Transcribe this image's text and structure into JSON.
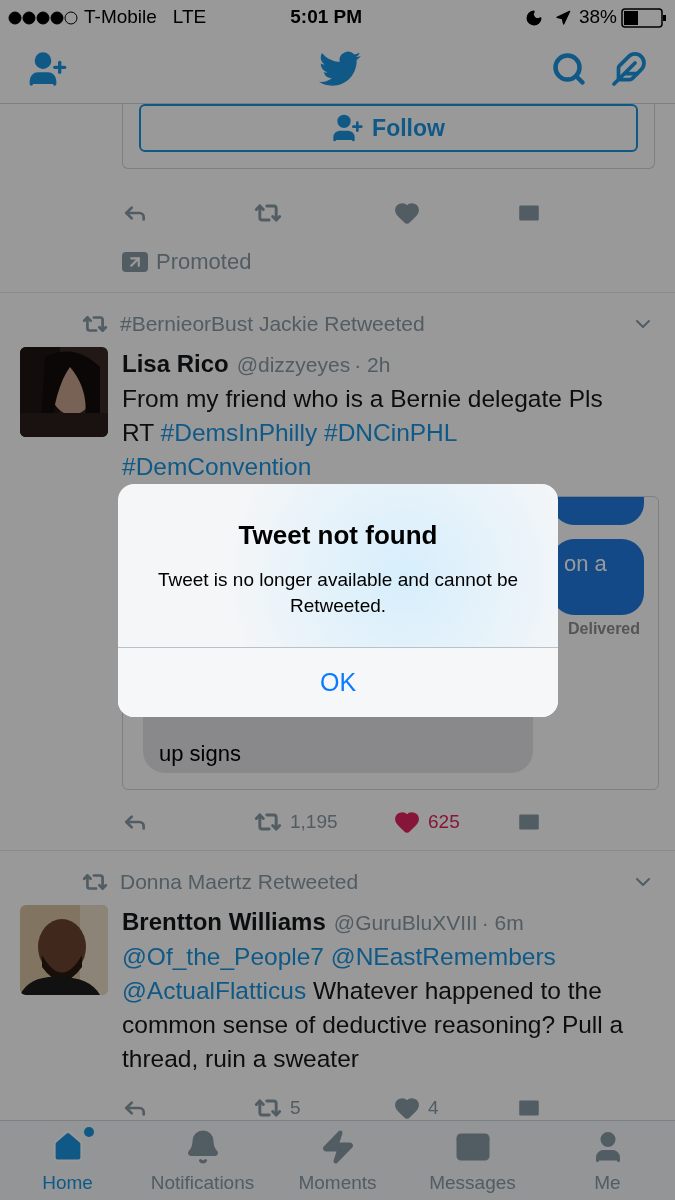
{
  "status_bar": {
    "carrier": "T-Mobile",
    "network": "LTE",
    "time": "5:01 PM",
    "battery": "38%"
  },
  "promoted_tweet": {
    "follow_button": "Follow",
    "promoted_label": "Promoted"
  },
  "tweets": [
    {
      "retweeted_by": "#BernieorBust Jackie Retweeted",
      "name": "Lisa Rico",
      "handle": "@dizzyeyes",
      "time": "· 2h",
      "text": [
        {
          "kind": "plain",
          "text": "From my friend who is a Bernie delegate Pls RT"
        },
        {
          "kind": "link",
          "text": "#DemsInPhilly"
        },
        {
          "kind": "link",
          "text": "#DNCinPHL"
        },
        {
          "kind": "link",
          "text": "#DemConvention"
        }
      ],
      "media": {
        "bubbles": [
          {
            "kind": "sent"
          },
          {
            "kind": "sent",
            "text": "on a"
          },
          {
            "kind": "status",
            "text": "Delivered"
          },
          {
            "kind": "received",
            "text": "up signs"
          }
        ]
      },
      "retweets": "1,195",
      "likes": "625",
      "liked": true
    },
    {
      "retweeted_by": "Donna Maertz Retweeted",
      "name": "Brentton Williams",
      "handle": "@GuruBluXVIII",
      "time": "· 6m",
      "text": [
        {
          "kind": "link",
          "text": "@Of_the_People7"
        },
        {
          "kind": "link",
          "text": "@NEastRemembers"
        },
        {
          "kind": "link",
          "text": "@ActualFlatticus"
        },
        {
          "kind": "plain",
          "text": "Whatever happened to the common sense of deductive reasoning? Pull a thread, ruin a sweater"
        }
      ],
      "retweets": "5",
      "likes": "4",
      "liked": false
    }
  ],
  "tabs": [
    {
      "label": "Home",
      "selected": true,
      "dot": true
    },
    {
      "label": "Notifications",
      "selected": false,
      "dot": false
    },
    {
      "label": "Moments",
      "selected": false,
      "dot": false
    },
    {
      "label": "Messages",
      "selected": false,
      "dot": false
    },
    {
      "label": "Me",
      "selected": false,
      "dot": false
    }
  ],
  "dialog": {
    "title": "Tweet not found",
    "message": "Tweet is no longer available and cannot be Retweeted.",
    "button": "OK"
  }
}
